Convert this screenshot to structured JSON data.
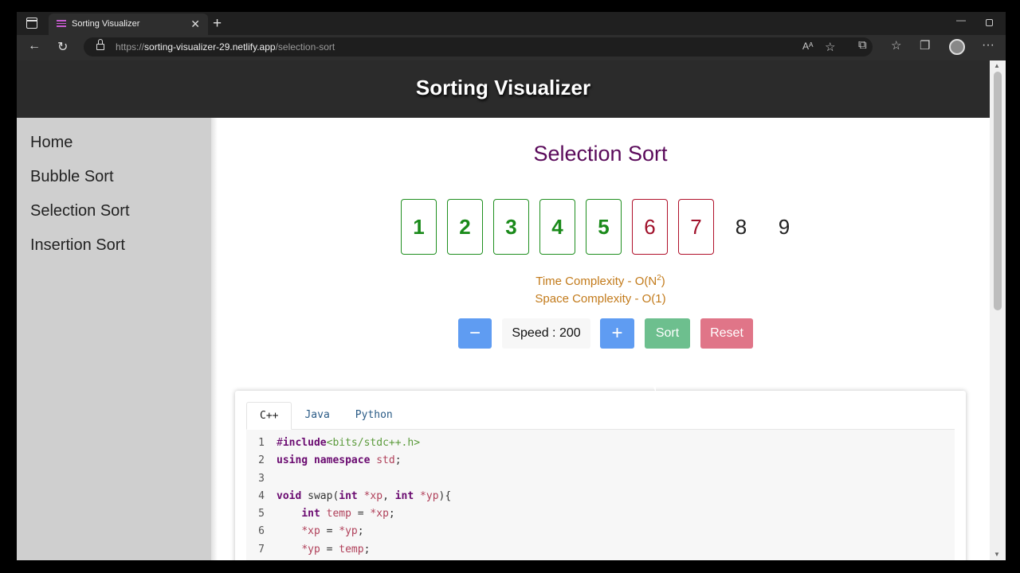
{
  "browser": {
    "tab_title": "Sorting Visualizer",
    "url_prefix": "https://",
    "url_host": "sorting-visualizer-29.netlify.app",
    "url_path": "/selection-sort"
  },
  "header": {
    "title": "Sorting Visualizer"
  },
  "sidebar": {
    "items": [
      {
        "label": "Home"
      },
      {
        "label": "Bubble Sort"
      },
      {
        "label": "Selection Sort"
      },
      {
        "label": "Insertion Sort"
      }
    ]
  },
  "main": {
    "title": "Selection Sort",
    "array": [
      {
        "value": "1",
        "state": "sorted"
      },
      {
        "value": "2",
        "state": "sorted"
      },
      {
        "value": "3",
        "state": "sorted"
      },
      {
        "value": "4",
        "state": "sorted"
      },
      {
        "value": "5",
        "state": "sorted"
      },
      {
        "value": "6",
        "state": "active"
      },
      {
        "value": "7",
        "state": "active"
      },
      {
        "value": "8",
        "state": "plain"
      },
      {
        "value": "9",
        "state": "plain"
      }
    ],
    "time_complexity_prefix": "Time Complexity - O(N",
    "time_complexity_exp": "2",
    "time_complexity_suffix": ")",
    "space_complexity": "Space Complexity - O(1)",
    "controls": {
      "minus": "−",
      "speed": "Speed : 200",
      "plus": "+",
      "sort": "Sort",
      "reset": "Reset"
    }
  },
  "code": {
    "tabs": [
      "C++",
      "Java",
      "Python"
    ],
    "lines": [
      {
        "n": "1",
        "parts": [
          [
            "pp",
            "#"
          ],
          [
            "kw",
            "include"
          ],
          [
            "str",
            "<bits/stdc++.h>"
          ]
        ]
      },
      {
        "n": "2",
        "parts": [
          [
            "kw",
            "using namespace"
          ],
          [
            "var",
            " std"
          ],
          [
            "pl",
            ";"
          ]
        ]
      },
      {
        "n": "3",
        "parts": []
      },
      {
        "n": "4",
        "parts": [
          [
            "kw",
            "void"
          ],
          [
            "pl",
            " swap("
          ],
          [
            "kw",
            "int"
          ],
          [
            "pl",
            " "
          ],
          [
            "var",
            "*xp"
          ],
          [
            "pl",
            ", "
          ],
          [
            "kw",
            "int"
          ],
          [
            "pl",
            " "
          ],
          [
            "var",
            "*yp"
          ],
          [
            "pl",
            "){"
          ]
        ]
      },
      {
        "n": "5",
        "parts": [
          [
            "pl",
            "    "
          ],
          [
            "kw",
            "int"
          ],
          [
            "pl",
            " "
          ],
          [
            "var",
            "temp"
          ],
          [
            "pl",
            " = "
          ],
          [
            "var",
            "*xp"
          ],
          [
            "pl",
            ";"
          ]
        ]
      },
      {
        "n": "6",
        "parts": [
          [
            "pl",
            "    "
          ],
          [
            "var",
            "*xp"
          ],
          [
            "pl",
            " = "
          ],
          [
            "var",
            "*yp"
          ],
          [
            "pl",
            ";"
          ]
        ]
      },
      {
        "n": "7",
        "parts": [
          [
            "pl",
            "    "
          ],
          [
            "var",
            "*yp"
          ],
          [
            "pl",
            " = "
          ],
          [
            "var",
            "temp"
          ],
          [
            "pl",
            ";"
          ]
        ]
      }
    ]
  },
  "colors": {
    "header_bg": "#2b2b2b",
    "sidebar_bg": "#cfcfcf",
    "title": "#5a0a5a",
    "sorted": "#1a8a1a",
    "active": "#a0102a",
    "complexity": "#c27a1a",
    "minus_btn": "#5f9cf2",
    "plus_btn": "#5f9cf2",
    "sort_btn": "#6dbf8e",
    "reset_btn": "#e07588"
  }
}
